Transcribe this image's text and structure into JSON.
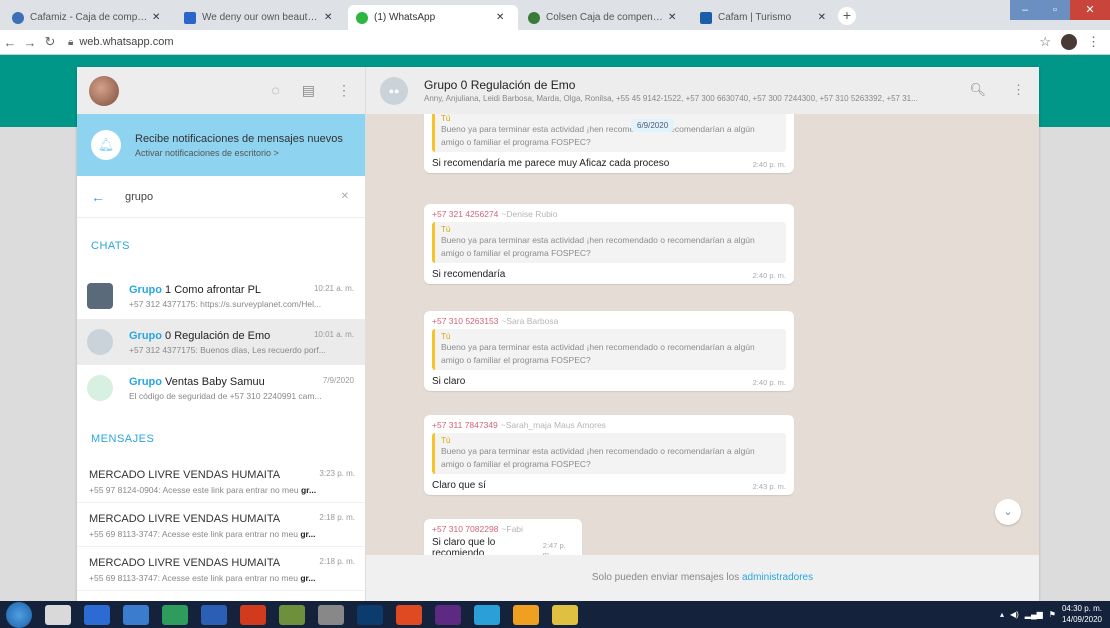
{
  "browser": {
    "tabs": [
      {
        "title": "Cafamiz - Caja de compensación",
        "favicon_color": "#3c6fb5",
        "active": false
      },
      {
        "title": "We deny our own beauty becaus",
        "favicon_color": "#2a66c9",
        "active": false
      },
      {
        "title": "(1) WhatsApp",
        "favicon_color": "#2bb741",
        "active": true
      },
      {
        "title": "Colsen Caja de compensación",
        "favicon_color": "#3a7a3a",
        "active": false
      },
      {
        "title": "Cafam | Turismo",
        "favicon_color": "#1c5fa8",
        "active": false
      }
    ],
    "new_tab": "+",
    "url": "web.whatsapp.com"
  },
  "sidebar": {
    "notification": {
      "title": "Recibe notificaciones de mensajes nuevos",
      "link": "Activar notificaciones de escritorio >"
    },
    "search_query": "grupo",
    "chats_label": "CHATS",
    "chats": [
      {
        "bold": "Grupo",
        "rest": " 1 Como afrontar PL",
        "time": "10:21 a. m.",
        "preview": "+57 312 4377175: https://s.surveyplanet.com/Hel...",
        "avatar_color": "#5a6a7a",
        "selected": false
      },
      {
        "bold": "Grupo",
        "rest": " 0 Regulación de Emo",
        "time": "10:01 a. m.",
        "preview": "+57 312 4377175: Buenos días, Les recuerdo porf...",
        "avatar_color": "#c9d3d9",
        "selected": true
      },
      {
        "bold": "Grupo",
        "rest": " Ventas Baby Samuu",
        "time": "7/9/2020",
        "preview": "El código de seguridad de +57 310 2240991 cam...",
        "avatar_color": "#d8f0e0",
        "selected": false
      }
    ],
    "messages_label": "MENSAJES",
    "messages": [
      {
        "name": "MERCADO LIVRE VENDAS HUMAITA",
        "time": "3:23 p. m.",
        "preview": "+55 97 8124-0904: Acesse este link para entrar no meu ",
        "highlight": "gr..."
      },
      {
        "name": "MERCADO LIVRE VENDAS HUMAITA",
        "time": "2:18 p. m.",
        "preview": "+55 69 8113-3747: Acesse este link para entrar no meu ",
        "highlight": "gr..."
      },
      {
        "name": "MERCADO LIVRE VENDAS HUMAITA",
        "time": "2:18 p. m.",
        "preview": "+55 69 8113-3747: Acesse este link para entrar no meu ",
        "highlight": "gr..."
      }
    ]
  },
  "conversation": {
    "title": "Grupo 0 Regulación de Emo",
    "members": "Anny, Anjuliana, Leidi Barbosa, Marda, Olga, Ronilsa, +55 45 9142-1522, +57 300 6630740, +57 300 7244300, +57 310 5263392, +57 31...",
    "date_chip": "6/9/2020",
    "messages": [
      {
        "sender_phone": "",
        "sender_name": "",
        "quote_author": "Tú",
        "quote_text": "Bueno ya para terminar esta actividad ¡hen recomendado o recomendarían a algún amigo o familiar el programa FOSPEC?",
        "text": "Si recomendaría me parece muy Aficaz cada proceso",
        "time": "2:40 p. m."
      },
      {
        "sender_phone": "+57 321 4256274",
        "sender_name": "~Denise Rubio",
        "quote_author": "Tú",
        "quote_text": "Bueno ya para terminar esta actividad ¡hen recomendado o recomendarían a algún amigo o familiar el programa FOSPEC?",
        "text": "Si recomendaría",
        "time": "2:40 p. m."
      },
      {
        "sender_phone": "+57 310 5263153",
        "sender_name": "~Sara Barbosa",
        "quote_author": "Tú",
        "quote_text": "Bueno ya para terminar esta actividad ¡hen recomendado o recomendarían a algún amigo o familiar el programa FOSPEC?",
        "text": "Si claro",
        "time": "2:40 p. m."
      },
      {
        "sender_phone": "+57 311 7847349",
        "sender_name": "~Sarah_maja Maus Amores",
        "quote_author": "Tú",
        "quote_text": "Bueno ya para terminar esta actividad ¡hen recomendado o recomendarían a algún amigo o familiar el programa FOSPEC?",
        "text": "Claro que sí",
        "time": "2:43 p. m."
      },
      {
        "sender_phone": "+57 310 7082298",
        "sender_name": "~Fabi",
        "quote_author": "",
        "quote_text": "",
        "text": "Si claro que lo recomiendo",
        "time": "2:47 p. m."
      }
    ],
    "footer_text": "Solo pueden enviar mensajes los ",
    "footer_link": "administradores"
  },
  "taskbar": {
    "icon_colors": [
      "#d9d9d9",
      "#2d6bd4",
      "#3b7ccf",
      "#2d9c5c",
      "#2b5fb5",
      "#d23a1e",
      "#6e8f3c",
      "#888888",
      "#0c3b6e",
      "#e04a22",
      "#5c2a80",
      "#2a9fd8",
      "#f0a020",
      "#e0c040"
    ],
    "time": "04:30 p. m.",
    "date": "14/09/2020"
  }
}
